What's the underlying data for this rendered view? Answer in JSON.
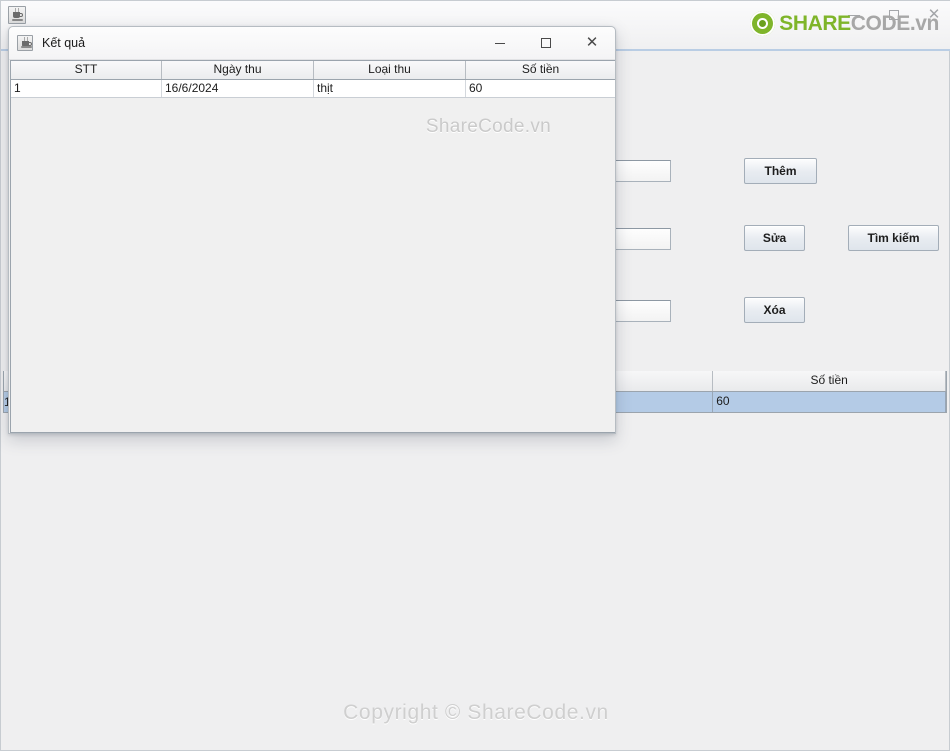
{
  "background_window": {
    "title_icon": "java-coffee-cup-icon",
    "window_controls": {
      "minimize": "–",
      "maximize": "□",
      "close": "✕"
    },
    "fields": [
      {
        "name": "field-1",
        "value": "",
        "placeholder": ""
      },
      {
        "name": "field-2",
        "value": "",
        "placeholder": ""
      },
      {
        "name": "field-3",
        "value": "",
        "placeholder": ""
      }
    ],
    "buttons": {
      "them": "Thêm",
      "sua": "Sửa",
      "xoa": "Xóa",
      "tim_kiem": "Tìm kiếm"
    },
    "table": {
      "headers": [
        "",
        "Số tiền"
      ],
      "rows": [
        {
          "stt": "1",
          "left": "",
          "so_tien": "60",
          "selected": true
        }
      ]
    }
  },
  "watermarks": {
    "logo": {
      "share": "SHARE",
      "code": "CODE",
      "vn": ".vn"
    },
    "dialog_watermark": "ShareCode.vn",
    "copyright": "Copyright © ShareCode.vn"
  },
  "dialog": {
    "title": "Kết quả",
    "title_icon": "java-coffee-cup-icon",
    "window_controls": {
      "minimize": "–",
      "maximize": "□",
      "close": "✕"
    },
    "table": {
      "headers": [
        "STT",
        "Ngày thu",
        "Loại thu",
        "Số tiền"
      ],
      "rows": [
        {
          "stt": "1",
          "ngay_thu": "16/6/2024",
          "loai_thu": "thịt",
          "so_tien": "60"
        }
      ]
    }
  },
  "colors": {
    "accent_blue": "#b9cde4",
    "selection_blue": "#b4cbe6",
    "logo_green": "#7fb52a",
    "logo_gray": "#a7a7a7",
    "window_bg": "#efeff0"
  }
}
